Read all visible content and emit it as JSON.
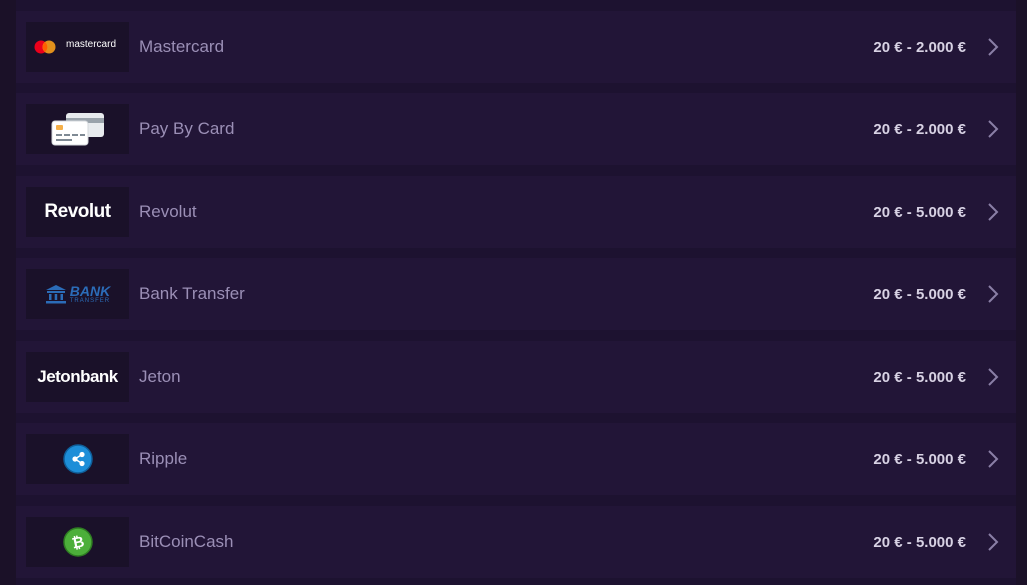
{
  "methods": [
    {
      "name": "Mastercard",
      "range": "20 € - 2.000 €",
      "logo": {
        "icon": "mastercard-logo",
        "text": "mastercard"
      }
    },
    {
      "name": "Pay By Card",
      "range": "20 € - 2.000 €",
      "logo": {
        "icon": "credit-cards-icon"
      }
    },
    {
      "name": "Revolut",
      "range": "20 € - 5.000 €",
      "logo": {
        "icon": "revolut-logo",
        "text": "Revolut"
      }
    },
    {
      "name": "Bank Transfer",
      "range": "20 € - 5.000 €",
      "logo": {
        "icon": "bank-transfer-logo",
        "text": "BANK",
        "subtext": "TRANSFER"
      }
    },
    {
      "name": "Jeton",
      "range": "20 € - 5.000 €",
      "logo": {
        "icon": "jetonbank-logo",
        "text": "Jetonbank"
      }
    },
    {
      "name": "Ripple",
      "range": "20 € - 5.000 €",
      "logo": {
        "icon": "ripple-icon"
      }
    },
    {
      "name": "BitCoinCash",
      "range": "20 € - 5.000 €",
      "logo": {
        "icon": "bitcoin-cash-icon"
      }
    }
  ],
  "colors": {
    "background": "#1d1230",
    "row": "#221537",
    "logo_box": "#1a1129",
    "name_text": "#9b8fb6",
    "range_text": "#d8d2e4",
    "bank_blue": "#2b6cb8",
    "ripple_blue": "#1d8ed8",
    "bch_green": "#4caf3a"
  }
}
